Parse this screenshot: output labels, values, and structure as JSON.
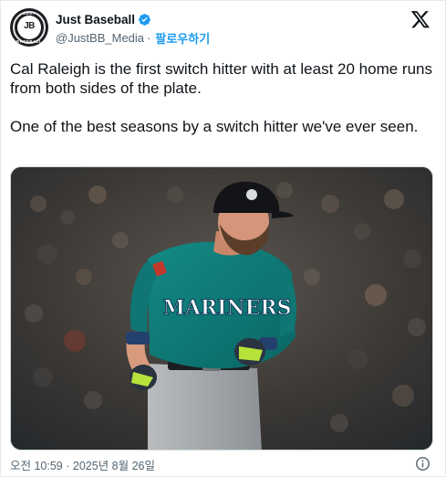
{
  "author": {
    "display_name": "Just Baseball",
    "handle": "@JustBB_Media",
    "separator": "·",
    "follow_label": "팔로우하기",
    "avatar_text": "JB",
    "avatar_arc_top": "JUST",
    "avatar_arc_bottom": "BASEBALL",
    "verified_icon": "verified-badge-icon"
  },
  "tweet": {
    "paragraph_1": "Cal Raleigh is the first switch hitter with at least 20 home runs from both sides of the plate.",
    "paragraph_2": "One of the best seasons by a switch hitter we've ever seen."
  },
  "media": {
    "jersey_text": "MARINERS"
  },
  "footer": {
    "timestamp": "오전 10:59 · 2025년 8월 26일"
  },
  "icons": {
    "platform": "x-logo-icon",
    "info": "info-icon"
  },
  "colors": {
    "accent": "#1d9bf0",
    "text": "#0f1419",
    "muted": "#536471",
    "jersey": "#0b7d7a"
  }
}
